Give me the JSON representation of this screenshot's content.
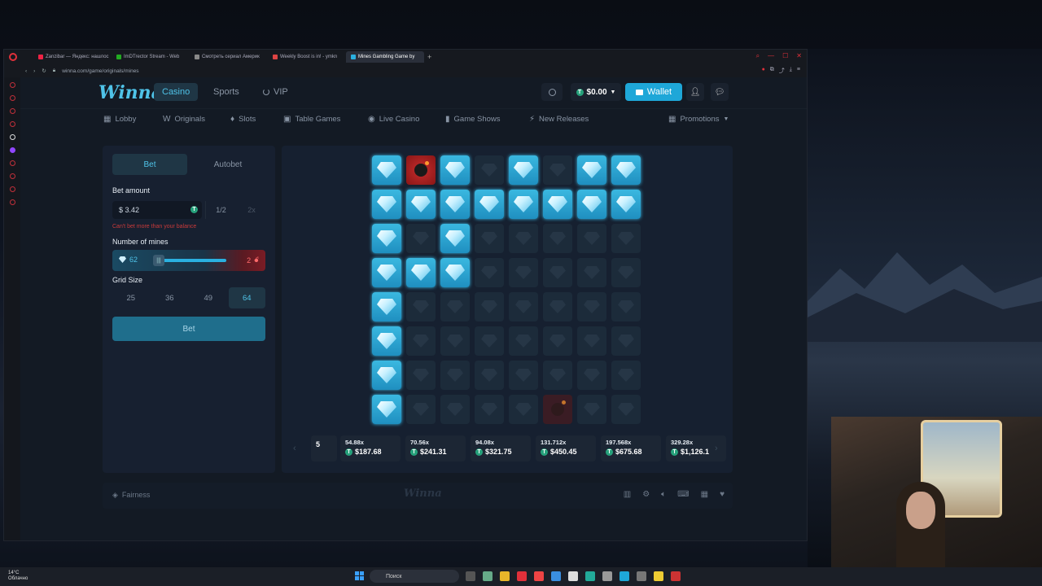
{
  "browser": {
    "tabs": [
      {
        "label": "Zanzibar — Яндекс: нашлос",
        "active": false
      },
      {
        "label": "ImDTrector Stream - Web",
        "active": false
      },
      {
        "label": "Смотреть сериал Америк",
        "active": false
      },
      {
        "label": "Weekly Boost is in! - ymkn",
        "active": false
      },
      {
        "label": "Mines Gambling Game by",
        "active": true
      }
    ],
    "url": "winna.com/game/originals/mines"
  },
  "site": {
    "logo": "Winna",
    "nav": {
      "casino": "Casino",
      "sports": "Sports",
      "vip": "VIP"
    },
    "balance": "$0.00",
    "wallet_label": "Wallet",
    "subnav": [
      {
        "label": "Lobby",
        "icon": "grid-icon"
      },
      {
        "label": "Originals",
        "icon": "originals-icon"
      },
      {
        "label": "Slots",
        "icon": "slots-icon"
      },
      {
        "label": "Table Games",
        "icon": "table-games-icon"
      },
      {
        "label": "Live Casino",
        "icon": "live-icon"
      },
      {
        "label": "Game Shows",
        "icon": "game-shows-icon"
      },
      {
        "label": "New Releases",
        "icon": "lightning-icon"
      }
    ],
    "promotions": "Promotions"
  },
  "bet_panel": {
    "tab_bet": "Bet",
    "tab_autobet": "Autobet",
    "amount_label": "Bet amount",
    "amount_value": "$ 3.42",
    "half": "1/2",
    "double": "2x",
    "error": "Can't bet more than your balance",
    "mines_label": "Number of mines",
    "gems": "62",
    "mines": "2",
    "mines_fraction": 0.03,
    "grid_size_label": "Grid Size",
    "grid_sizes": [
      "25",
      "36",
      "49",
      "64"
    ],
    "grid_selected": "64",
    "bet_button": "Bet"
  },
  "board": {
    "rows": [
      [
        "gem",
        "bomb",
        "gem",
        "hidden",
        "gem",
        "hidden",
        "gem",
        "gem"
      ],
      [
        "gem",
        "gem",
        "gem",
        "gem",
        "gem",
        "gem",
        "gem",
        "gem"
      ],
      [
        "gem",
        "hidden",
        "gem",
        "hidden",
        "hidden",
        "hidden",
        "hidden",
        "hidden"
      ],
      [
        "gem",
        "gem",
        "gem",
        "hidden",
        "hidden",
        "hidden",
        "hidden",
        "hidden"
      ],
      [
        "gem",
        "hidden",
        "hidden",
        "hidden",
        "hidden",
        "hidden",
        "hidden",
        "hidden"
      ],
      [
        "gem",
        "hidden",
        "hidden",
        "hidden",
        "hidden",
        "hidden",
        "hidden",
        "hidden"
      ],
      [
        "gem",
        "hidden",
        "hidden",
        "hidden",
        "hidden",
        "hidden",
        "hidden",
        "hidden"
      ],
      [
        "gem",
        "hidden",
        "hidden",
        "hidden",
        "hidden",
        "bomb-dim",
        "hidden",
        "hidden"
      ]
    ]
  },
  "multipliers": [
    {
      "mult": "",
      "value": "5"
    },
    {
      "mult": "54.88x",
      "value": "$187.68"
    },
    {
      "mult": "70.56x",
      "value": "$241.31"
    },
    {
      "mult": "94.08x",
      "value": "$321.75"
    },
    {
      "mult": "131.712x",
      "value": "$450.45"
    },
    {
      "mult": "197.568x",
      "value": "$675.68"
    },
    {
      "mult": "329.28x",
      "value": "$1,126.1"
    }
  ],
  "footer": {
    "fairness": "Fairness",
    "logo": "Winna"
  },
  "taskbar": {
    "weather_temp": "14°C",
    "weather_desc": "Облачно",
    "search": "Поиск"
  }
}
